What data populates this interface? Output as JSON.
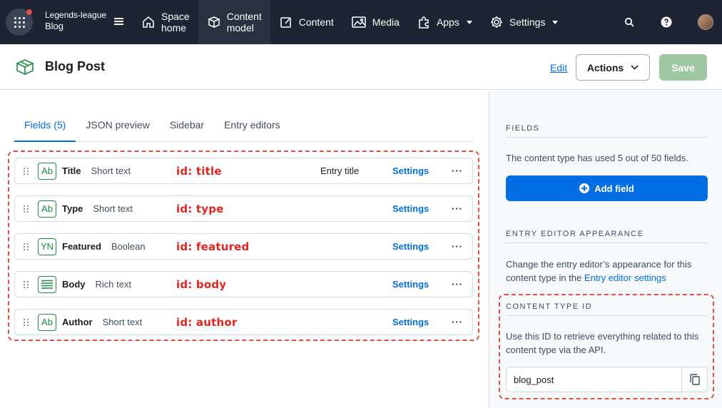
{
  "topnav": {
    "space_org": "Legends-league",
    "space_env": "Blog",
    "items": [
      {
        "label_line1": "Space",
        "label_line2": "home",
        "icon": "home-icon"
      },
      {
        "label_line1": "Content",
        "label_line2": "model",
        "icon": "content-model-icon"
      },
      {
        "label": "Content",
        "icon": "content-icon"
      },
      {
        "label": "Media",
        "icon": "media-icon"
      },
      {
        "label": "Apps",
        "icon": "apps-icon"
      },
      {
        "label": "Settings",
        "icon": "gear-icon"
      }
    ]
  },
  "header": {
    "title": "Blog Post",
    "edit_label": "Edit",
    "actions_label": "Actions",
    "save_label": "Save"
  },
  "tabs": [
    "Fields (5)",
    "JSON preview",
    "Sidebar",
    "Entry editors"
  ],
  "fields": [
    {
      "icon_text": "Ab",
      "name": "Title",
      "type": "Short text",
      "id_note": "id: title",
      "extra": "Entry title",
      "settings": "Settings",
      "more": "···"
    },
    {
      "icon_text": "Ab",
      "name": "Type",
      "type": "Short text",
      "id_note": "id: type",
      "extra": "",
      "settings": "Settings",
      "more": "···"
    },
    {
      "icon_text": "YN",
      "name": "Featured",
      "type": "Boolean",
      "id_note": "id: featured",
      "extra": "",
      "settings": "Settings",
      "more": "···"
    },
    {
      "icon_text": "",
      "name": "Body",
      "type": "Rich text",
      "id_note": "id: body",
      "extra": "",
      "settings": "Settings",
      "more": "···"
    },
    {
      "icon_text": "Ab",
      "name": "Author",
      "type": "Short text",
      "id_note": "id: author",
      "extra": "",
      "settings": "Settings",
      "more": "···"
    }
  ],
  "sidebar": {
    "fields_title": "FIELDS",
    "fields_text": "The content type has used 5 out of 50 fields.",
    "add_field_label": "Add field",
    "appearance_title": "ENTRY EDITOR APPEARANCE",
    "appearance_text": "Change the entry editor’s appearance for this content type in the",
    "appearance_link": "Entry editor settings",
    "ctid_title": "CONTENT TYPE ID",
    "ctid_text": "Use this ID to retrieve everything related to this content type via the API.",
    "ctid_value": "blog_post"
  },
  "colors": {
    "nav_bg": "#1e2433",
    "primary": "#036fe3",
    "save_disabled": "#9fc8a2",
    "annotation": "#e0503d",
    "field_icon": "#1f8a45"
  }
}
